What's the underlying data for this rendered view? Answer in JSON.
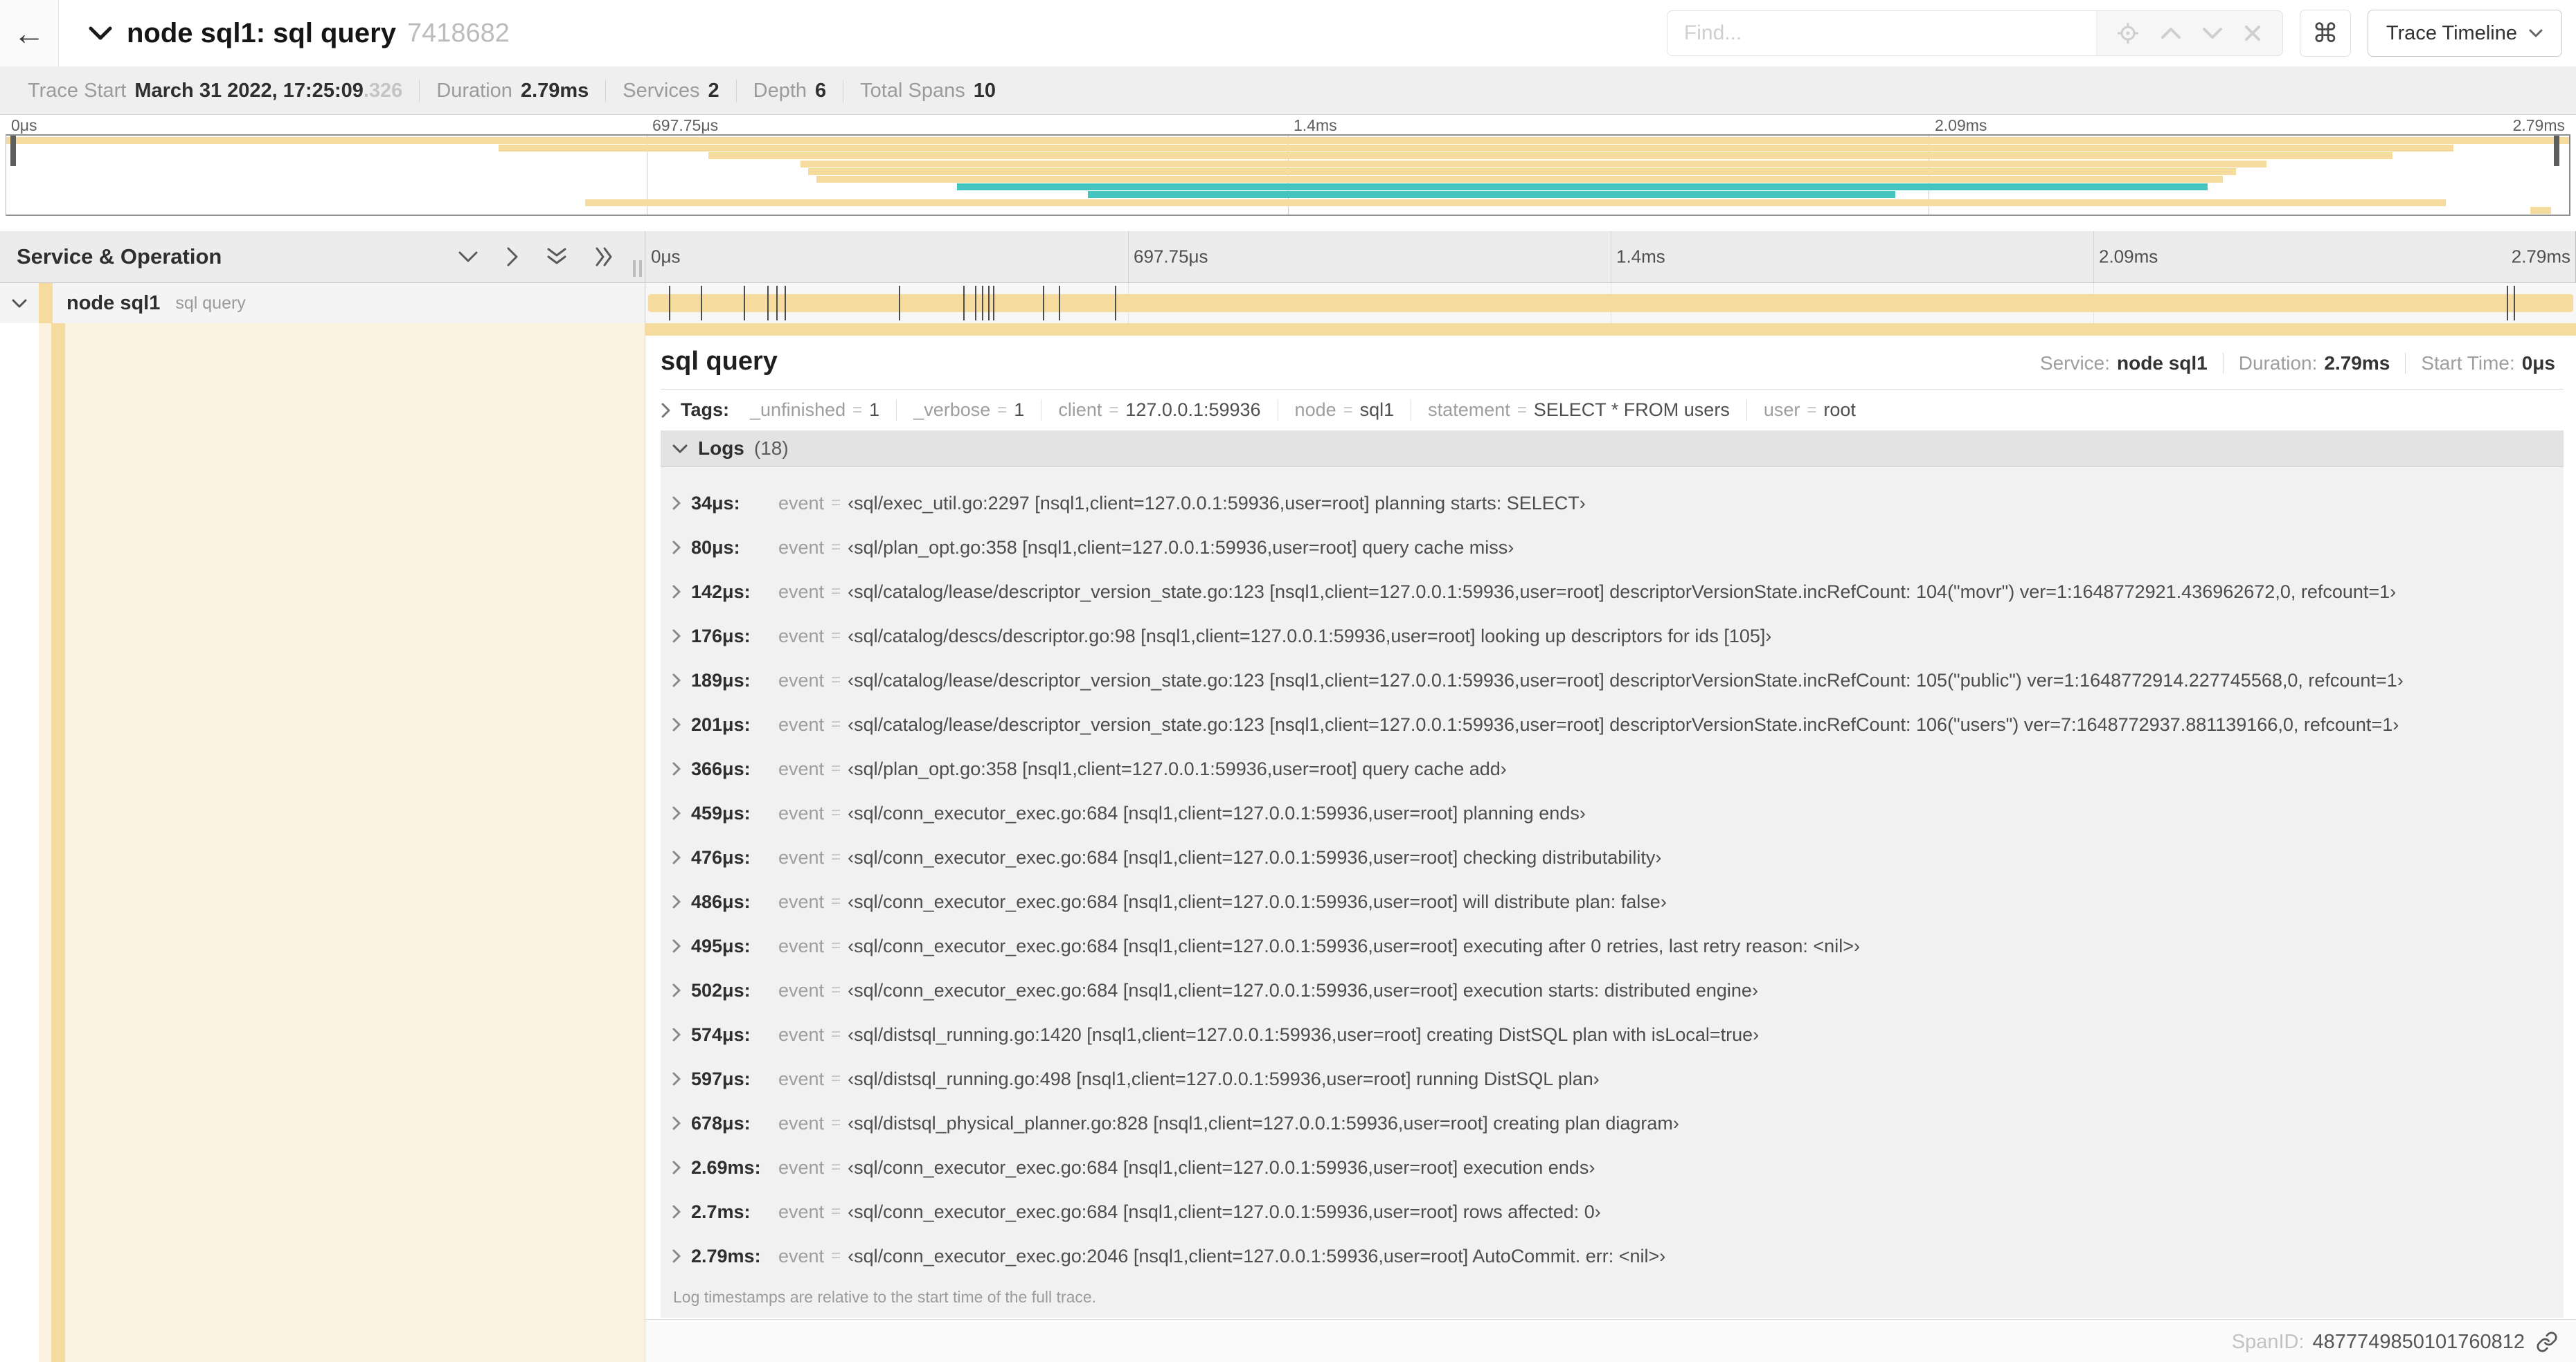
{
  "misc": {
    "eq": "="
  },
  "header": {
    "title": "node sql1: sql query",
    "trace_id": "7418682",
    "find_placeholder": "Find...",
    "shortcut_label": "⌘",
    "view_selector_label": "Trace Timeline"
  },
  "trace_info": {
    "items": [
      {
        "label": "Trace Start",
        "value": "March 31 2022, 17:25:09",
        "suffix": ".326"
      },
      {
        "label": "Duration",
        "value": "2.79ms",
        "suffix": ""
      },
      {
        "label": "Services",
        "value": "2",
        "suffix": ""
      },
      {
        "label": "Depth",
        "value": "6",
        "suffix": ""
      },
      {
        "label": "Total Spans",
        "value": "10",
        "suffix": ""
      }
    ]
  },
  "minimap": {
    "colors": {
      "tan": "#f6db9f",
      "teal": "#45c5c0"
    },
    "ticks": [
      {
        "label": "0μs",
        "pos": 0
      },
      {
        "label": "697.75μs",
        "pos": 25
      },
      {
        "label": "1.4ms",
        "pos": 50
      },
      {
        "label": "2.09ms",
        "pos": 75
      },
      {
        "label": "2.79ms",
        "pos": 100
      }
    ],
    "spans": [
      {
        "row": 0,
        "start": 0,
        "end": 100,
        "color": "tan"
      },
      {
        "row": 1,
        "start": 19.2,
        "end": 95.5,
        "color": "tan"
      },
      {
        "row": 2,
        "start": 27.4,
        "end": 93.1,
        "color": "tan"
      },
      {
        "row": 3,
        "start": 31.0,
        "end": 88.2,
        "color": "tan"
      },
      {
        "row": 4,
        "start": 31.3,
        "end": 87.0,
        "color": "tan"
      },
      {
        "row": 5,
        "start": 31.6,
        "end": 86.5,
        "color": "tan"
      },
      {
        "row": 6,
        "start": 37.1,
        "end": 85.9,
        "color": "teal"
      },
      {
        "row": 7,
        "start": 42.2,
        "end": 73.7,
        "color": "teal"
      },
      {
        "row": 8,
        "start": 22.6,
        "end": 95.2,
        "color": "tan"
      },
      {
        "row": 9,
        "start": 98.5,
        "end": 99.3,
        "color": "tan"
      }
    ]
  },
  "timeline": {
    "left_header": "Service & Operation",
    "total_us": 2790,
    "row": {
      "service": "node sql1",
      "operation": "sql query"
    }
  },
  "detail": {
    "title": "sql query",
    "service_label": "Service:",
    "service": "node sql1",
    "duration_label": "Duration:",
    "duration": "2.79ms",
    "start_label": "Start Time:",
    "start": "0μs",
    "tags_label": "Tags:",
    "tags": [
      {
        "key": "_unfinished",
        "value": "1"
      },
      {
        "key": "_verbose",
        "value": "1"
      },
      {
        "key": "client",
        "value": "127.0.0.1:59936"
      },
      {
        "key": "node",
        "value": "sql1"
      },
      {
        "key": "statement",
        "value": "SELECT * FROM users"
      },
      {
        "key": "user",
        "value": "root"
      }
    ],
    "logs_title": "Logs",
    "logs_count": "(18)",
    "log_key_label": "event",
    "logs": [
      {
        "t": "34μs:",
        "t_us": 34,
        "value": "‹sql/exec_util.go:2297 [nsql1,client=127.0.0.1:59936,user=root] planning starts: SELECT›"
      },
      {
        "t": "80μs:",
        "t_us": 80,
        "value": "‹sql/plan_opt.go:358 [nsql1,client=127.0.0.1:59936,user=root] query cache miss›"
      },
      {
        "t": "142μs:",
        "t_us": 142,
        "value": "‹sql/catalog/lease/descriptor_version_state.go:123 [nsql1,client=127.0.0.1:59936,user=root] descriptorVersionState.incRefCount: 104(\"movr\") ver=1:1648772921.436962672,0, refcount=1›"
      },
      {
        "t": "176μs:",
        "t_us": 176,
        "value": "‹sql/catalog/descs/descriptor.go:98 [nsql1,client=127.0.0.1:59936,user=root] looking up descriptors for ids [105]›"
      },
      {
        "t": "189μs:",
        "t_us": 189,
        "value": "‹sql/catalog/lease/descriptor_version_state.go:123 [nsql1,client=127.0.0.1:59936,user=root] descriptorVersionState.incRefCount: 105(\"public\") ver=1:1648772914.227745568,0, refcount=1›"
      },
      {
        "t": "201μs:",
        "t_us": 201,
        "value": "‹sql/catalog/lease/descriptor_version_state.go:123 [nsql1,client=127.0.0.1:59936,user=root] descriptorVersionState.incRefCount: 106(\"users\") ver=7:1648772937.881139166,0, refcount=1›"
      },
      {
        "t": "366μs:",
        "t_us": 366,
        "value": "‹sql/plan_opt.go:358 [nsql1,client=127.0.0.1:59936,user=root] query cache add›"
      },
      {
        "t": "459μs:",
        "t_us": 459,
        "value": "‹sql/conn_executor_exec.go:684 [nsql1,client=127.0.0.1:59936,user=root] planning ends›"
      },
      {
        "t": "476μs:",
        "t_us": 476,
        "value": "‹sql/conn_executor_exec.go:684 [nsql1,client=127.0.0.1:59936,user=root] checking distributability›"
      },
      {
        "t": "486μs:",
        "t_us": 486,
        "value": "‹sql/conn_executor_exec.go:684 [nsql1,client=127.0.0.1:59936,user=root] will distribute plan: false›"
      },
      {
        "t": "495μs:",
        "t_us": 495,
        "value": "‹sql/conn_executor_exec.go:684 [nsql1,client=127.0.0.1:59936,user=root] executing after 0 retries, last retry reason: <nil>›"
      },
      {
        "t": "502μs:",
        "t_us": 502,
        "value": "‹sql/conn_executor_exec.go:684 [nsql1,client=127.0.0.1:59936,user=root] execution starts: distributed engine›"
      },
      {
        "t": "574μs:",
        "t_us": 574,
        "value": "‹sql/distsql_running.go:1420 [nsql1,client=127.0.0.1:59936,user=root] creating DistSQL plan with isLocal=true›"
      },
      {
        "t": "597μs:",
        "t_us": 597,
        "value": "‹sql/distsql_running.go:498 [nsql1,client=127.0.0.1:59936,user=root] running DistSQL plan›"
      },
      {
        "t": "678μs:",
        "t_us": 678,
        "value": "‹sql/distsql_physical_planner.go:828 [nsql1,client=127.0.0.1:59936,user=root] creating plan diagram›"
      },
      {
        "t": "2.69ms:",
        "t_us": 2690,
        "value": "‹sql/conn_executor_exec.go:684 [nsql1,client=127.0.0.1:59936,user=root] execution ends›"
      },
      {
        "t": "2.7ms:",
        "t_us": 2700,
        "value": "‹sql/conn_executor_exec.go:684 [nsql1,client=127.0.0.1:59936,user=root] rows affected: 0›"
      },
      {
        "t": "2.79ms:",
        "t_us": 2790,
        "value": "‹sql/conn_executor_exec.go:2046 [nsql1,client=127.0.0.1:59936,user=root] AutoCommit. err: <nil>›"
      }
    ],
    "logs_note": "Log timestamps are relative to the start time of the full trace.",
    "spanid_label": "SpanID:",
    "spanid_value": "4877749850101760812"
  }
}
